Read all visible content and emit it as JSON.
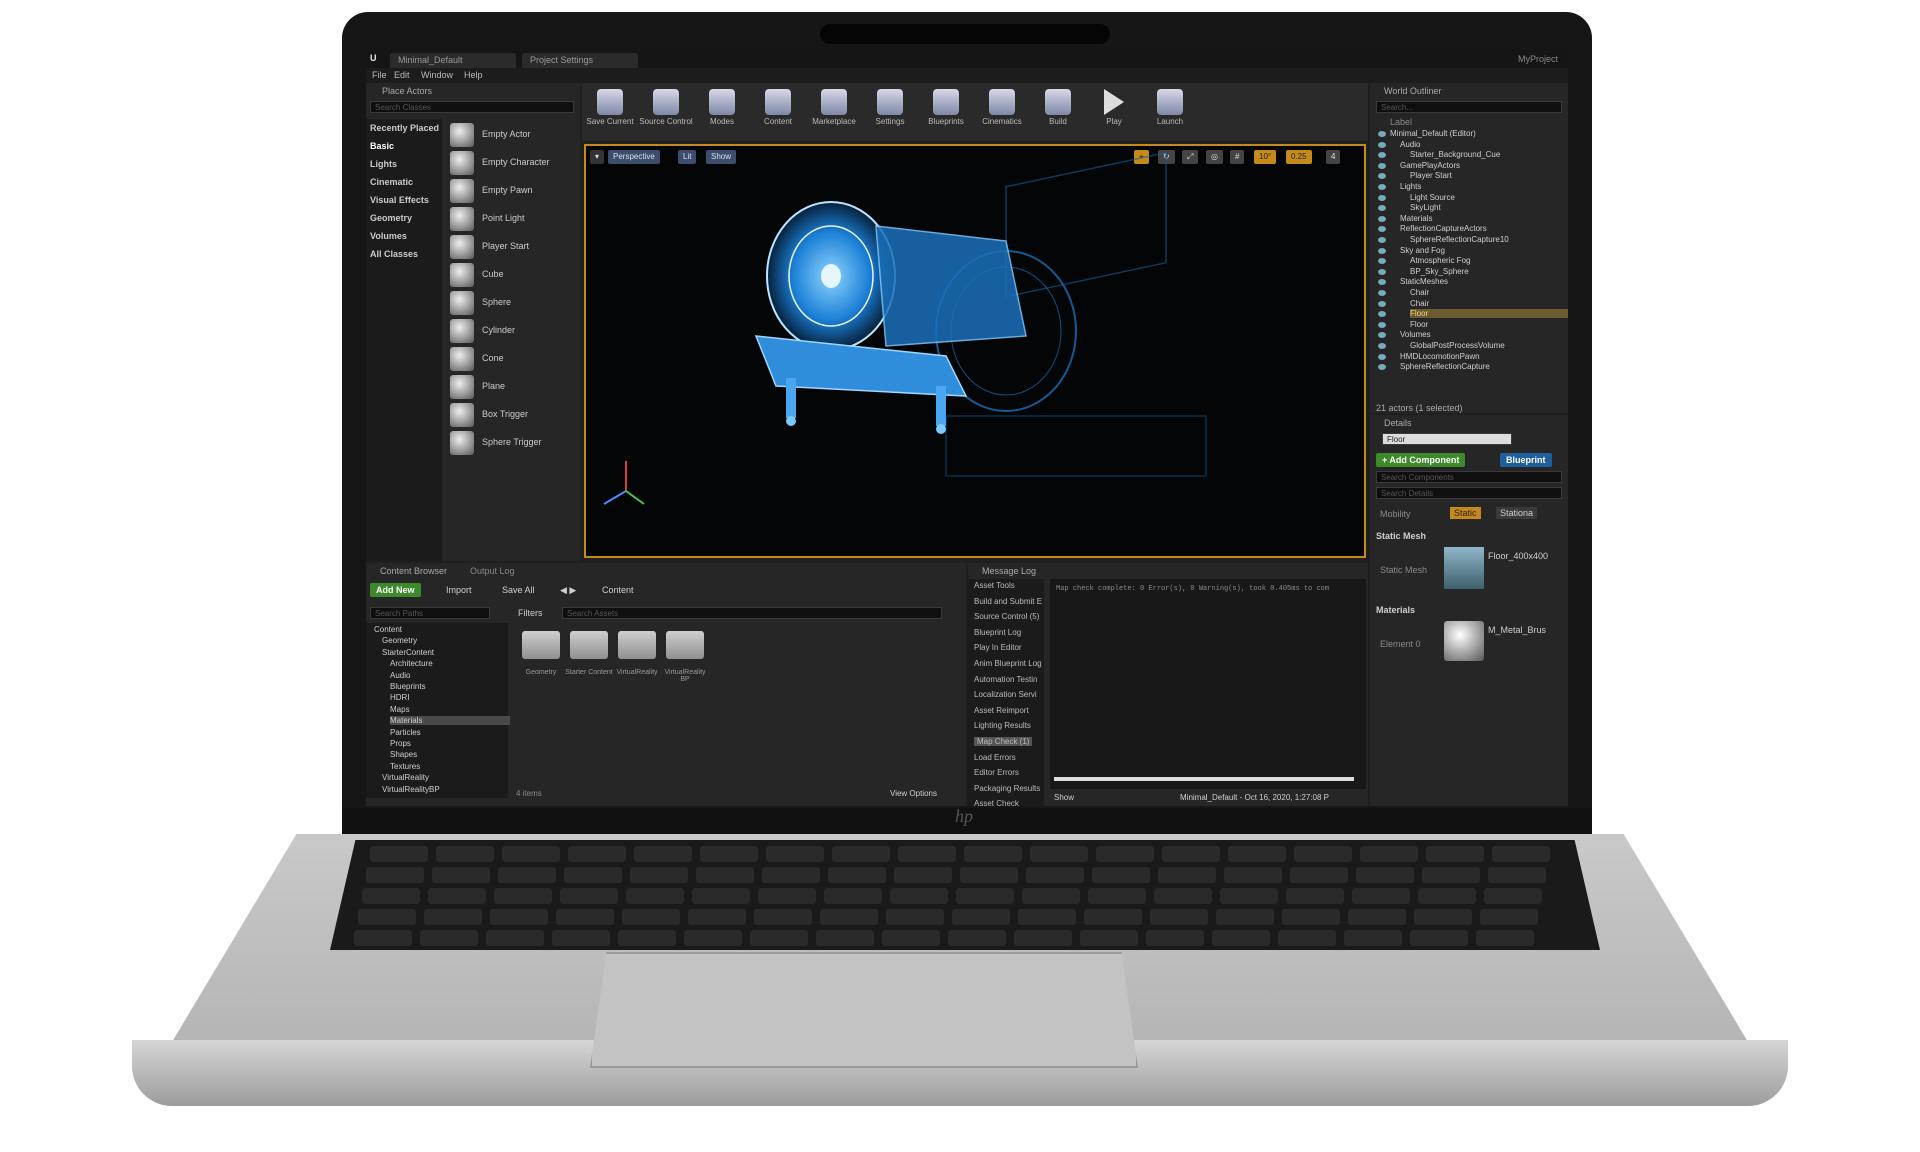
{
  "editor": {
    "tabs": [
      "Minimal_Default",
      "Project Settings"
    ],
    "project_name": "MyProject",
    "menu": [
      "File",
      "Edit",
      "Window",
      "Help"
    ]
  },
  "place_actors": {
    "title": "Place Actors",
    "search_placeholder": "Search Classes",
    "categories": [
      "Recently Placed",
      "Basic",
      "Lights",
      "Cinematic",
      "Visual Effects",
      "Geometry",
      "Volumes",
      "All Classes"
    ],
    "actors": [
      "Empty Actor",
      "Empty Character",
      "Empty Pawn",
      "Point Light",
      "Player Start",
      "Cube",
      "Sphere",
      "Cylinder",
      "Cone",
      "Plane",
      "Box Trigger",
      "Sphere Trigger"
    ]
  },
  "toolbar": {
    "buttons": [
      "Save Current",
      "Source Control",
      "Modes",
      "Content",
      "Marketplace",
      "Settings",
      "Blueprints",
      "Cinematics",
      "Build",
      "Play",
      "Launch"
    ]
  },
  "viewport": {
    "perspective": "Perspective",
    "lit": "Lit",
    "show": "Show",
    "snap_angle": "10°",
    "scale": "0.25",
    "camera_speed": "4"
  },
  "outliner": {
    "title": "World Outliner",
    "search_placeholder": "Search...",
    "column": "Label",
    "items": [
      "Minimal_Default (Editor)",
      "Audio",
      "Starter_Background_Cue",
      "GamePlayActors",
      "Player Start",
      "Lights",
      "Light Source",
      "SkyLight",
      "Materials",
      "ReflectionCaptureActors",
      "SphereReflectionCapture10",
      "Sky and Fog",
      "Atmospheric Fog",
      "BP_Sky_Sphere",
      "StaticMeshes",
      "Chair",
      "Chair",
      "Floor",
      "Floor",
      "Volumes",
      "GlobalPostProcessVolume",
      "HMDLocomotionPawn",
      "SphereReflectionCapture"
    ],
    "summary": "21 actors (1 selected)"
  },
  "details": {
    "title": "Details",
    "name_value": "Floor",
    "add_component": "+ Add Component",
    "blueprint": "Blueprint",
    "search_components": "Search Components",
    "search_details": "Search Details",
    "mobility_label": "Mobility",
    "mobility_static": "Static",
    "mobility_stationary": "Stationa",
    "static_mesh_section": "Static Mesh",
    "static_mesh_label": "Static Mesh",
    "static_mesh_value": "Floor_400x400",
    "materials_section": "Materials",
    "element_label": "Element 0",
    "material_value": "M_Metal_Brus"
  },
  "content_browser": {
    "tabs": [
      "Content Browser",
      "Output Log"
    ],
    "add_new": "Add New",
    "import": "Import",
    "save_all": "Save All",
    "path": "Content",
    "search_paths": "Search Paths",
    "filters": "Filters",
    "search_assets": "Search Assets",
    "tree": [
      "Content",
      "Geometry",
      "StarterContent",
      "Architecture",
      "Audio",
      "Blueprints",
      "HDRI",
      "Maps",
      "Materials",
      "Particles",
      "Props",
      "Shapes",
      "Textures",
      "VirtualReality",
      "VirtualRealityBP"
    ],
    "folders": [
      "Geometry",
      "Starter Content",
      "VirtualReality",
      "VirtualReality BP"
    ],
    "item_count": "4 items",
    "view_options": "View Options"
  },
  "message_log": {
    "title": "Message Log",
    "categories": [
      "Asset Tools",
      "Build and Submit E",
      "Source Control (5)",
      "Blueprint Log",
      "Play In Editor",
      "Anim Blueprint Log",
      "Automation Testin",
      "Localization Servi",
      "Asset Reimport",
      "Lighting Results",
      "Map Check (1)",
      "Load Errors",
      "Editor Errors",
      "Packaging Results",
      "Asset Check"
    ],
    "message": "Map check complete: 0 Error(s), 0 Warning(s), took 0.405ms to com",
    "show": "Show",
    "footer": "Minimal_Default - Oct 16, 2020, 1:27:08 P"
  },
  "colors": {
    "accent_orange": "#c58a1a",
    "selection": "#6b5a32",
    "green_button": "#3d8a2a",
    "blue_button": "#1f5fa0",
    "hologram": "#2fa8ff"
  }
}
